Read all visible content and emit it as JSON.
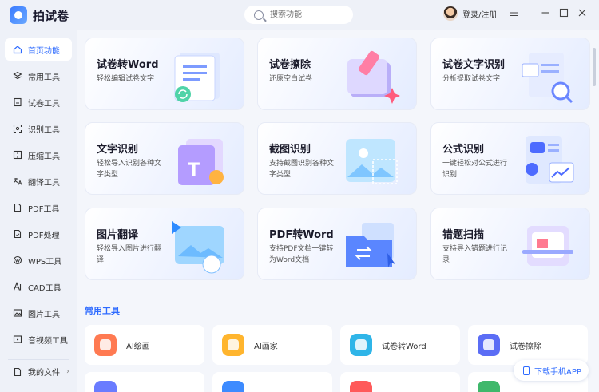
{
  "app": {
    "name": "拍试卷"
  },
  "search": {
    "placeholder": "搜索功能"
  },
  "user": {
    "login_label": "登录/注册"
  },
  "window": {
    "menu_icon": "hamburger-icon",
    "minimize_icon": "minimize-icon",
    "maximize_icon": "maximize-icon",
    "close_icon": "close-icon"
  },
  "sidebar": {
    "items": [
      {
        "label": "首页功能",
        "icon": "home-icon",
        "active": true
      },
      {
        "label": "常用工具",
        "icon": "layers-icon"
      },
      {
        "label": "试卷工具",
        "icon": "paper-icon"
      },
      {
        "label": "识别工具",
        "icon": "scan-icon"
      },
      {
        "label": "压缩工具",
        "icon": "compress-icon"
      },
      {
        "label": "翻译工具",
        "icon": "translate-icon"
      },
      {
        "label": "PDF工具",
        "icon": "pdf-icon"
      },
      {
        "label": "PDF处理",
        "icon": "pdf-process-icon"
      },
      {
        "label": "WPS工具",
        "icon": "wps-icon"
      },
      {
        "label": "CAD工具",
        "icon": "cad-icon"
      },
      {
        "label": "图片工具",
        "icon": "image-icon"
      },
      {
        "label": "音视频工具",
        "icon": "av-icon"
      }
    ],
    "my_files": "我的文件",
    "my_files_chevron": "›"
  },
  "cards": [
    {
      "title": "试卷转Word",
      "desc": "轻松编辑试卷文字"
    },
    {
      "title": "试卷擦除",
      "desc": "还原空白试卷"
    },
    {
      "title": "试卷文字识别",
      "desc": "分析提取试卷文字"
    },
    {
      "title": "文字识别",
      "desc": "轻松导入识别各种文字类型"
    },
    {
      "title": "截图识别",
      "desc": "支持截图识别各种文字类型"
    },
    {
      "title": "公式识别",
      "desc": "一键轻松对公式进行识别"
    },
    {
      "title": "图片翻译",
      "desc": "轻松导入图片进行翻译"
    },
    {
      "title": "PDF转Word",
      "desc": "支持PDF文档一键转为Word文档"
    },
    {
      "title": "错题扫描",
      "desc": "支持导入错题进行记录"
    }
  ],
  "common_tools": {
    "title": "常用工具",
    "items": [
      {
        "label": "AI绘画",
        "color": "#ff7a52"
      },
      {
        "label": "AI画家",
        "color": "#ffb52e"
      },
      {
        "label": "试卷转Word",
        "color": "#2fb5e8"
      },
      {
        "label": "试卷擦除",
        "color": "#5b6df5"
      }
    ]
  },
  "download_app": "下载手机APP",
  "colors": {
    "accent": "#2e6bff"
  }
}
